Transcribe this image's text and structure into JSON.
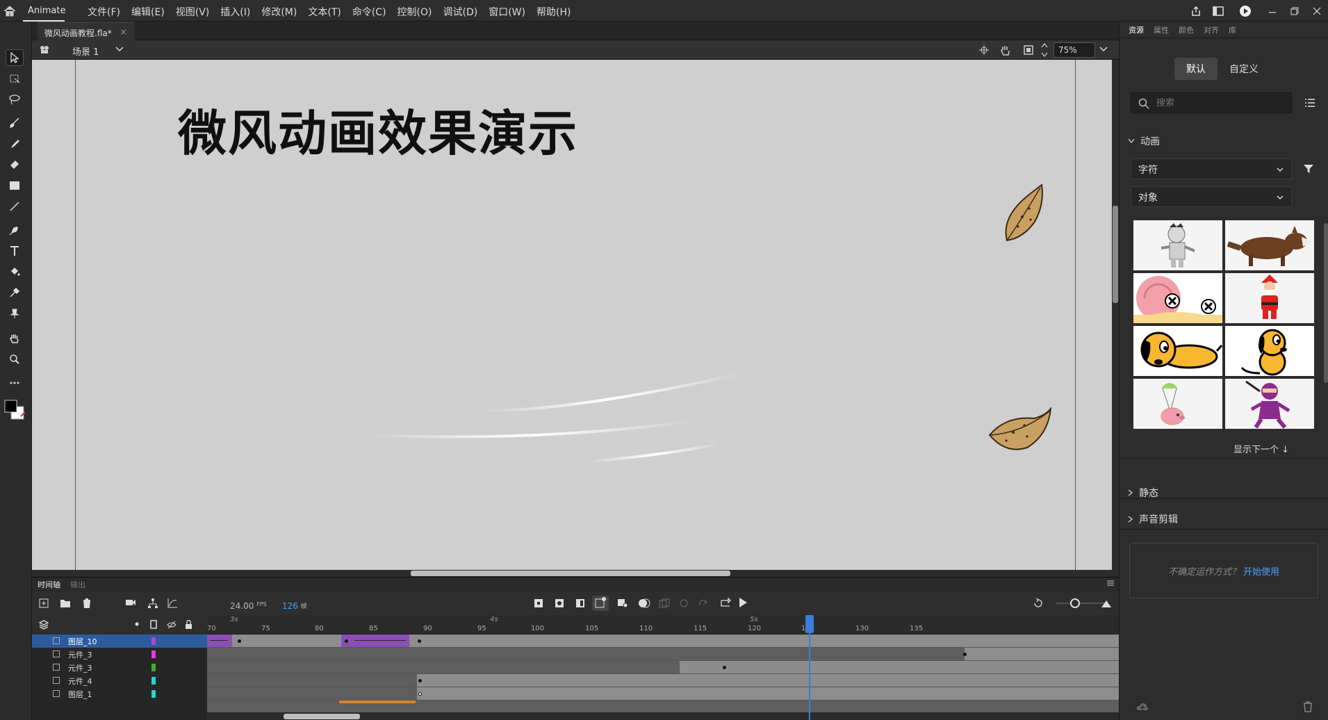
{
  "app": {
    "name": "Animate",
    "menus": [
      "文件(F)",
      "编辑(E)",
      "视图(V)",
      "插入(I)",
      "修改(M)",
      "文本(T)",
      "命令(C)",
      "控制(O)",
      "调试(D)",
      "窗口(W)",
      "帮助(H)"
    ]
  },
  "document": {
    "tab_title": "微风动画教程.fla*",
    "close_glyph": "×",
    "scene_label": "场景 1",
    "zoom": "75%"
  },
  "stage": {
    "title": "微风动画效果演示"
  },
  "right_panel": {
    "tabs": [
      "资源",
      "属性",
      "颜色",
      "对齐",
      "库"
    ],
    "segments": {
      "default": "默认",
      "custom": "自定义"
    },
    "search_placeholder": "搜索",
    "section_animation": "动画",
    "dropdown1": "字符",
    "dropdown2": "对象",
    "show_next": "显示下一个 ↓",
    "section_static": "静态",
    "section_sound": "声音剪辑",
    "help_text": "不确定运作方式？",
    "help_link": "开始使用"
  },
  "timeline": {
    "tabs": [
      "时间轴",
      "输出"
    ],
    "fps_value": "24.00",
    "fps_unit": "FPS",
    "frame_value": "126",
    "frame_unit": "帧",
    "ruler_seconds": [
      "3s",
      "4s",
      "5s"
    ],
    "ruler_frames": [
      "70",
      "75",
      "80",
      "85",
      "90",
      "95",
      "100",
      "105",
      "110",
      "115",
      "120",
      "125",
      "130",
      "135"
    ],
    "layers": [
      {
        "name": "图层_10",
        "color": "#c23bd6",
        "selected": true
      },
      {
        "name": "元件_3",
        "color": "#e53be0",
        "selected": false
      },
      {
        "name": "元件_3",
        "color": "#3fae2b",
        "selected": false
      },
      {
        "name": "元件_4",
        "color": "#25d4d4",
        "selected": false
      },
      {
        "name": "图层_1",
        "color": "#25d4d4",
        "selected": false
      }
    ]
  },
  "colors": {
    "accent": "#3b7dd8",
    "stage_bg": "#cfcfcf",
    "tween": "#8a4fb5"
  }
}
